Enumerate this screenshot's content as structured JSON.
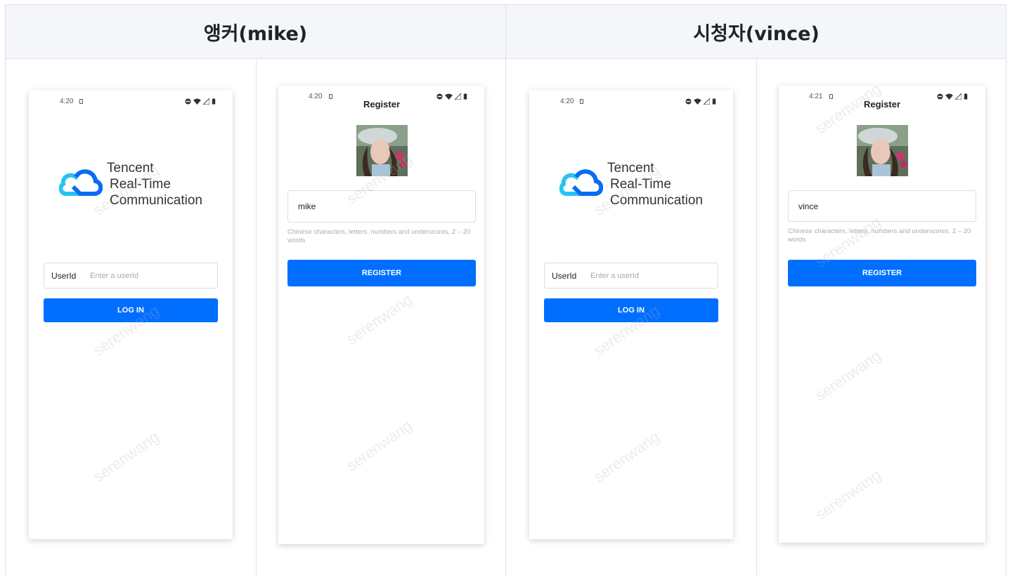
{
  "table": {
    "headers": [
      "앵커(mike)",
      "시청자(vince)"
    ]
  },
  "screens": {
    "anchor_login": {
      "time": "4:20",
      "logo_lines": [
        "Tencent",
        "Real-Time",
        "Communication"
      ],
      "userid_label": "UserId",
      "userid_placeholder": "Enter a userId",
      "login_label": "LOG IN"
    },
    "anchor_register": {
      "time": "4:20",
      "title": "Register",
      "name_value": "mike",
      "hint": "Chinese characters, letters, numbers and underscores, 2 – 20 words",
      "register_label": "REGISTER"
    },
    "viewer_login": {
      "time": "4:20",
      "logo_lines": [
        "Tencent",
        "Real-Time",
        "Communication"
      ],
      "userid_label": "UserId",
      "userid_placeholder": "Enter a userId",
      "login_label": "LOG IN"
    },
    "viewer_register": {
      "time": "4:21",
      "title": "Register",
      "name_value": "vince",
      "hint": "Chinese characters, letters, numbers and underscores, 2 – 20 words",
      "register_label": "REGISTER"
    }
  },
  "watermark": "serenwang",
  "colors": {
    "primary_button": "#006eff",
    "header_bg": "#f4f6fa",
    "border": "#dde2ea",
    "logo_light": "#27c3f3",
    "logo_dark": "#0a6cf0"
  },
  "icons": [
    "sim-card-icon",
    "do-not-disturb-icon",
    "wifi-icon",
    "signal-icon",
    "battery-icon",
    "cloud-logo-icon"
  ]
}
